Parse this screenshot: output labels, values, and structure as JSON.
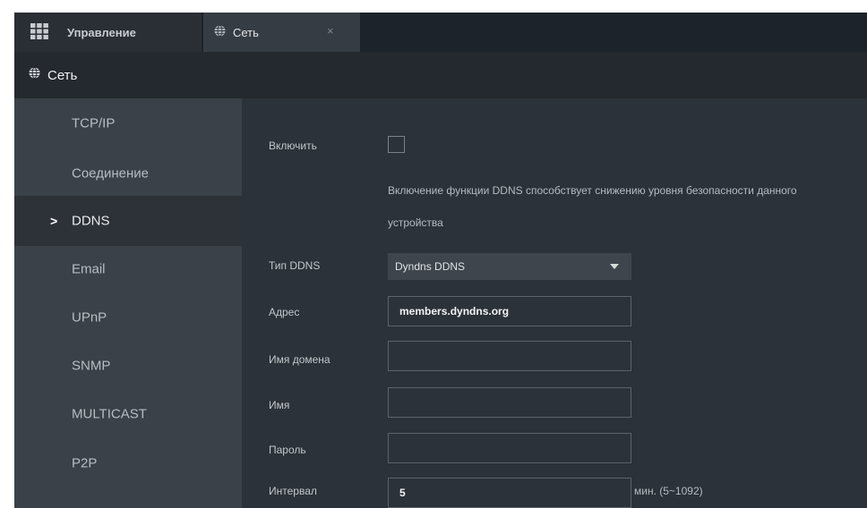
{
  "tabs": [
    {
      "label": "Управление",
      "icon": "grid-icon"
    },
    {
      "label": "Сеть",
      "icon": "globe-icon",
      "close": "×"
    }
  ],
  "header": {
    "title": "Сеть",
    "icon": "globe-icon"
  },
  "sidebar": {
    "active_index": 2,
    "active_marker": ">",
    "items": [
      {
        "label": "TCP/IP"
      },
      {
        "label": "Соединение"
      },
      {
        "label": "DDNS"
      },
      {
        "label": "Email"
      },
      {
        "label": "UPnP"
      },
      {
        "label": "SNMP"
      },
      {
        "label": "MULTICAST"
      },
      {
        "label": "P2P"
      }
    ]
  },
  "form": {
    "enable": {
      "label": "Включить",
      "checked": false
    },
    "warning": {
      "line1": "Включение функции DDNS способствует снижению уровня безопасности данного",
      "line2": "устройства"
    },
    "ddns_type": {
      "label": "Тип DDNS",
      "value": "Dyndns DDNS"
    },
    "address": {
      "label": "Адрес",
      "value": "members.dyndns.org"
    },
    "domain": {
      "label": "Имя домена",
      "value": ""
    },
    "username": {
      "label": "Имя",
      "value": ""
    },
    "password": {
      "label": "Пароль",
      "value": ""
    },
    "interval": {
      "label": "Интервал",
      "value": "5",
      "unit": "мин. (5~1092)"
    }
  },
  "colors": {
    "tabbar_bg": "#1d232b",
    "header_bg": "#24292f",
    "sidebar_bg": "#3a4148",
    "sidebar_active_bg": "#2c3238",
    "content_bg": "#2c3239",
    "text": "#c2c7cc"
  }
}
